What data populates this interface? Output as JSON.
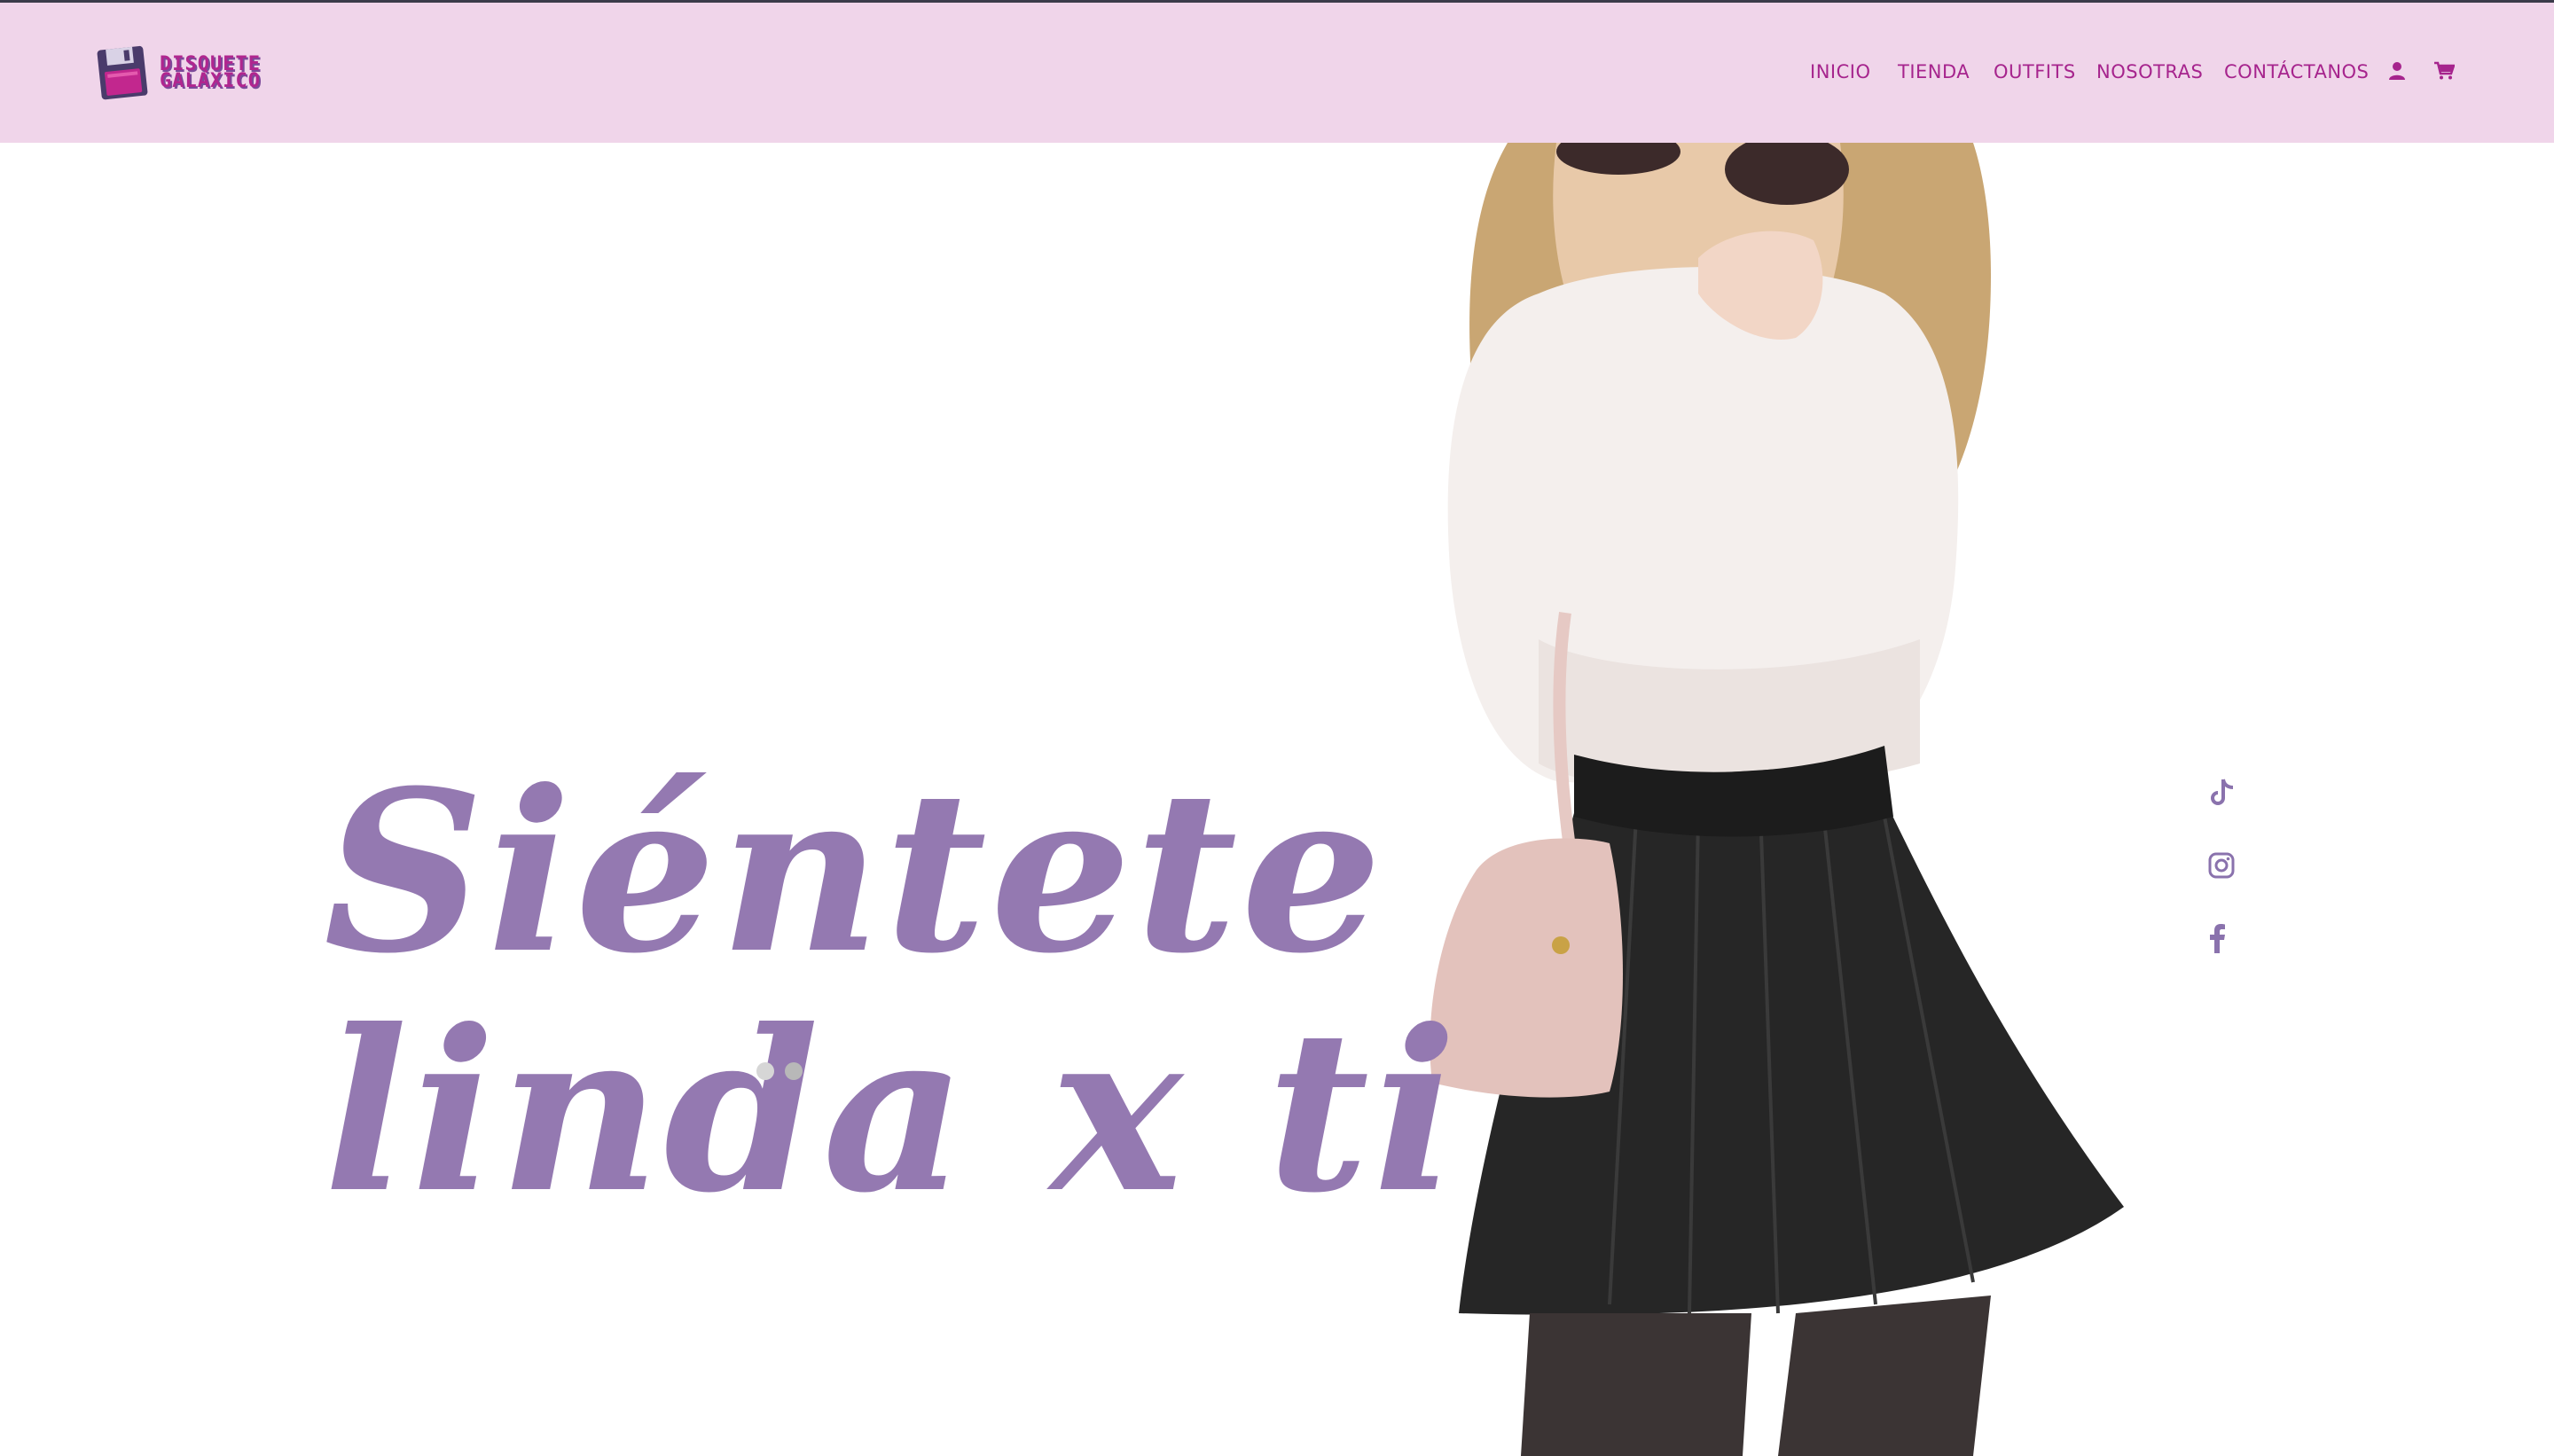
{
  "brand": {
    "name_line1": "DISQUETE",
    "name_line2": "GALAXICO",
    "logo_icon": "floppy-disk-icon"
  },
  "nav": {
    "links": [
      {
        "label": "INICIO"
      },
      {
        "label": "TIENDA"
      },
      {
        "label": "OUTFITS"
      },
      {
        "label": "NOSOTRAS"
      },
      {
        "label": "CONTÁCTANOS"
      }
    ],
    "account_icon": "user-icon",
    "cart_icon": "cart-icon"
  },
  "hero": {
    "headline_line1": "Siéntete",
    "headline_line2": "linda x ti",
    "image": "woman-in-white-sweater-and-black-skirt",
    "slides": 2,
    "active_slide": 2
  },
  "social": [
    {
      "icon": "tiktok-icon"
    },
    {
      "icon": "instagram-icon"
    },
    {
      "icon": "facebook-icon"
    }
  ],
  "colors": {
    "navbar_bg": "#f0d5ea",
    "nav_text": "#a6248d",
    "headline": "#9479b1",
    "social_icons": "#8a72ad",
    "dot_inactive": "#d6d6d6",
    "dot_active": "#b8b8b8"
  }
}
